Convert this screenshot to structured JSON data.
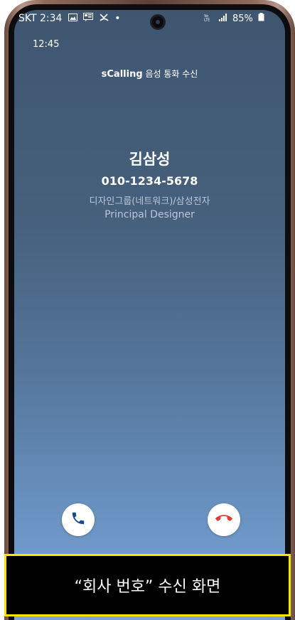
{
  "status_bar": {
    "carrier_time": "SKT 2:34",
    "left_icons": [
      "image-notification-icon",
      "message-notification-icon",
      "missed-call-icon",
      "dot-icon"
    ],
    "battery_text": "85%",
    "right_icons": [
      "volte-icon",
      "signal-icon",
      "battery-icon"
    ]
  },
  "screen": {
    "clock": "12:45",
    "app_brand": "sCalling",
    "app_subtitle": "음성 통화 수신"
  },
  "caller": {
    "name": "김삼성",
    "number": "010-1234-5678",
    "organization": "디자인그룹(네트워크)/삼성전자",
    "job_title": "Principal Designer"
  },
  "actions": {
    "accept_icon": "phone-accept-icon",
    "decline_icon": "phone-decline-icon",
    "accept_color": "#1a4a8a",
    "decline_color": "#e03a3a"
  },
  "caption": {
    "text": "“회사 번호” 수신 화면",
    "border_color": "#f5e600"
  }
}
